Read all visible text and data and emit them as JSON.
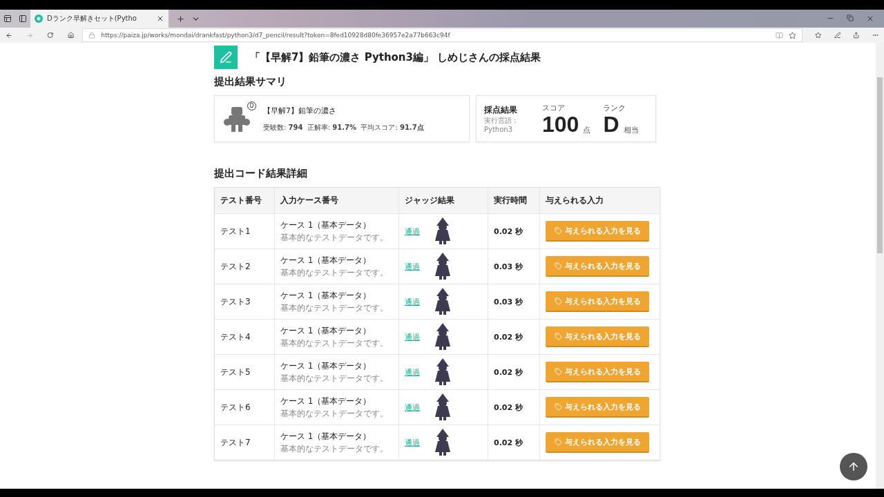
{
  "browser": {
    "tab_title": "Dランク早解きセット(Pytho",
    "url": "https://paiza.jp/works/mondai/drankfast/python3/d7_pencil/result?token=8fed10928d80fe36957e2a77b663c94f"
  },
  "page": {
    "title": "「【早解7】鉛筆の濃さ Python3編」 しめじさんの採点結果",
    "summary_heading": "提出結果サマリ",
    "problem": {
      "rank_mark": "D",
      "title": "【早解7】鉛筆の濃さ",
      "stats": "受験数: **794**  正解率: **91.7%**  平均スコア: **91.7点**"
    },
    "result": {
      "label": "採点結果",
      "lang_label": "実行言語：",
      "lang": "Python3",
      "score_label": "スコア",
      "score": "100",
      "score_unit": "点",
      "rank_label": "ランク",
      "rank": "D",
      "rank_suffix": "相当"
    },
    "detail_heading": "提出コード結果詳細",
    "table": {
      "columns": [
        "テスト番号",
        "入力ケース番号",
        "ジャッジ結果",
        "実行時間",
        "与えられる入力"
      ],
      "rows": [
        {
          "test": "テスト1",
          "case": "ケース 1（基本データ）",
          "case_note": "基本的なテストデータです。",
          "judge": "通過",
          "time": "0.02 秒",
          "button": "与えられる入力を見る"
        },
        {
          "test": "テスト2",
          "case": "ケース 1（基本データ）",
          "case_note": "基本的なテストデータです。",
          "judge": "通過",
          "time": "0.03 秒",
          "button": "与えられる入力を見る"
        },
        {
          "test": "テスト3",
          "case": "ケース 1（基本データ）",
          "case_note": "基本的なテストデータです。",
          "judge": "通過",
          "time": "0.03 秒",
          "button": "与えられる入力を見る"
        },
        {
          "test": "テスト4",
          "case": "ケース 1（基本データ）",
          "case_note": "基本的なテストデータです。",
          "judge": "通過",
          "time": "0.02 秒",
          "button": "与えられる入力を見る"
        },
        {
          "test": "テスト5",
          "case": "ケース 1（基本データ）",
          "case_note": "基本的なテストデータです。",
          "judge": "通過",
          "time": "0.02 秒",
          "button": "与えられる入力を見る"
        },
        {
          "test": "テスト6",
          "case": "ケース 1（基本データ）",
          "case_note": "基本的なテストデータです。",
          "judge": "通過",
          "time": "0.02 秒",
          "button": "与えられる入力を見る"
        },
        {
          "test": "テスト7",
          "case": "ケース 1（基本データ）",
          "case_note": "基本的なテストデータです。",
          "judge": "通過",
          "time": "0.02 秒",
          "button": "与えられる入力を見る"
        }
      ]
    }
  }
}
